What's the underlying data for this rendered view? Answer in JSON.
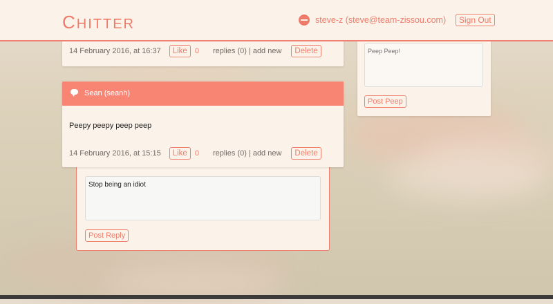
{
  "header": {
    "logo_first": "C",
    "logo_rest": "HITTER",
    "user_label": "steve-z (steve@team-zissou.com)",
    "signout_label": "Sign Out"
  },
  "peep1": {
    "date": "14 February 2016, at 16:37",
    "like_label": "Like",
    "like_count": "0",
    "replies_text": "replies (0) | add new",
    "delete_label": "Delete"
  },
  "peep2": {
    "author": "Sean (seanh)",
    "text": "Peepy peepy peep peep",
    "date": "14 February 2016, at 15:15",
    "like_label": "Like",
    "like_count": "0",
    "replies_text": "replies (0) | add new",
    "delete_label": "Delete"
  },
  "reply": {
    "input_value": "Stop being an idiot",
    "button_label": "Post Reply"
  },
  "new_peep": {
    "placeholder": "Peep Peep!",
    "button_label": "Post Peep"
  },
  "colors": {
    "accent": "#ee7b6a",
    "header_bg": "#fbf3ea",
    "card_head": "#f88474"
  }
}
